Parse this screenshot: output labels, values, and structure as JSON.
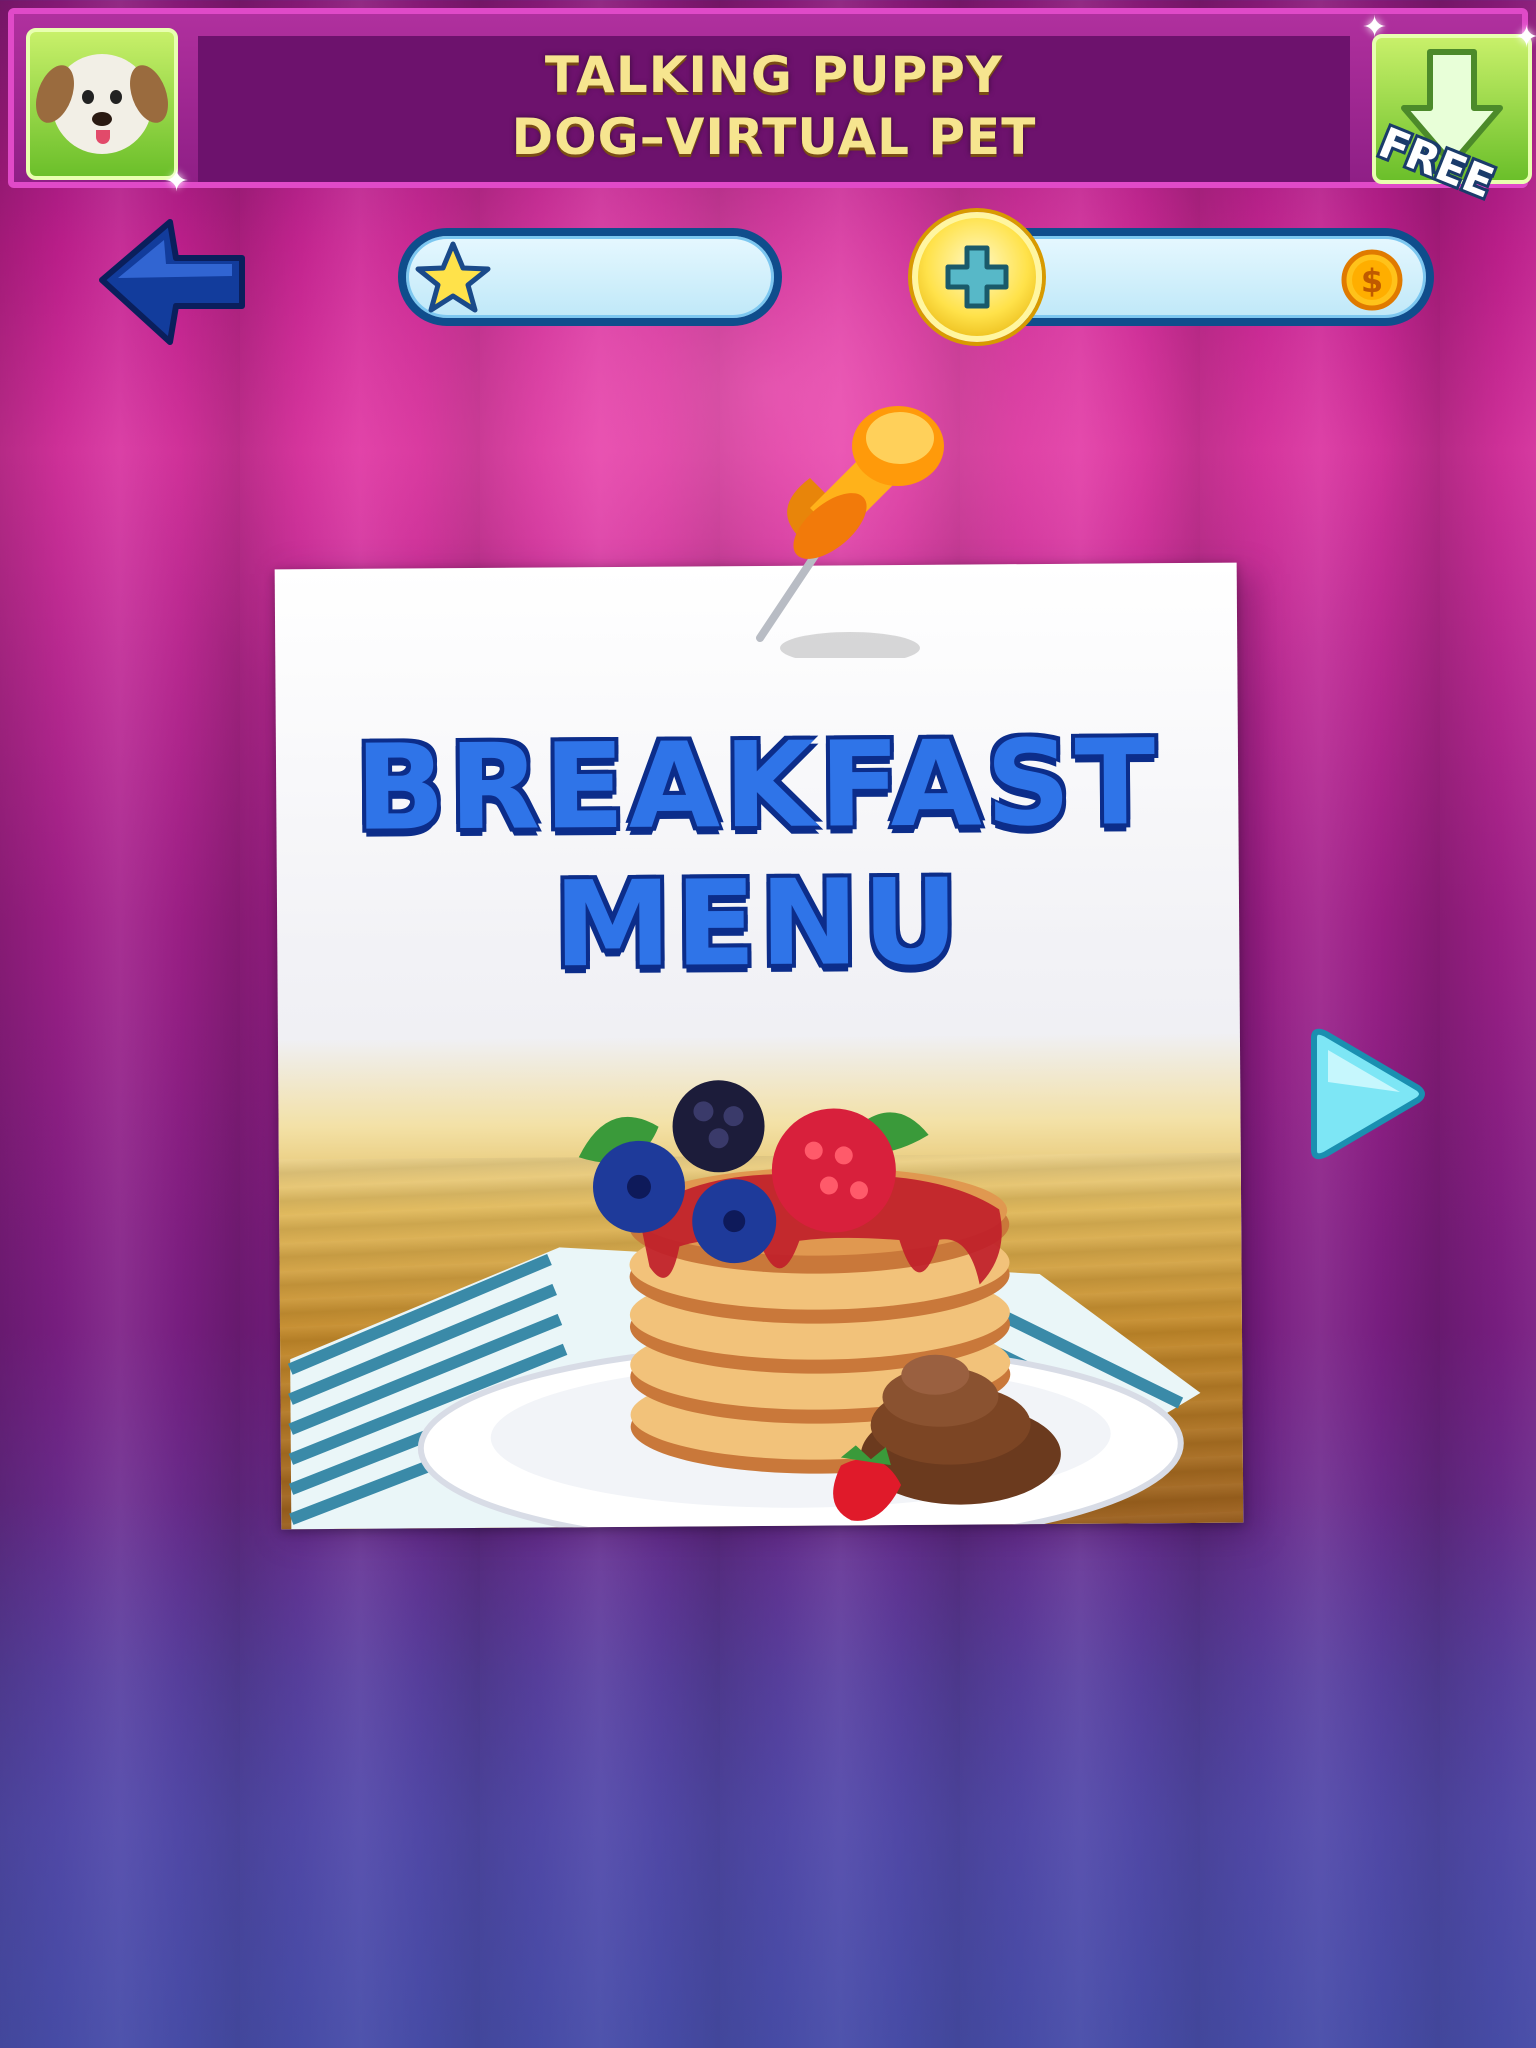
{
  "ad": {
    "title_line1": "TALKING PUPPY",
    "title_line2": "DOG–VIRTUAL PET",
    "badge": "FREE",
    "thumbnail_icon": "puppy-icon",
    "download_icon": "download-arrow-icon"
  },
  "hud": {
    "back_icon": "back-arrow-icon",
    "stars_icon": "star-icon",
    "stars_value": "",
    "add_coins_icon": "plus-icon",
    "coins_value": "",
    "coin_icon": "dollar-coin-icon"
  },
  "menu_card": {
    "title_line1": "BREAKFAST",
    "title_line2": "MENU",
    "pin_icon": "push-pin-icon",
    "image": "pancakes-with-berries"
  },
  "navigation": {
    "next_icon": "next-arrow-icon"
  },
  "colors": {
    "accent_blue": "#2f74e8",
    "outline_blue": "#0f4d8c",
    "curtain_pink": "#d8329f",
    "coin_gold": "#ffe24a"
  }
}
